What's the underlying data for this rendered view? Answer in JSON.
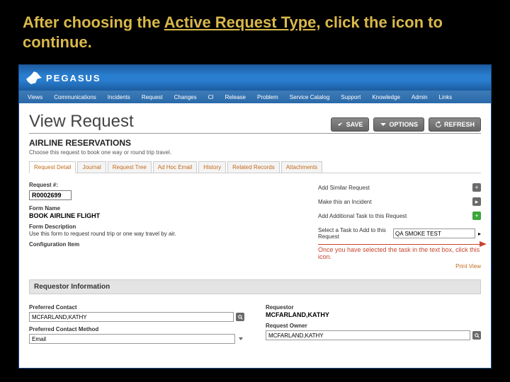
{
  "instruction": {
    "pre": "After choosing the ",
    "link": "Active Request Type,",
    "post": " click the icon  to continue."
  },
  "brand": "PEGASUS",
  "menu": [
    "Views",
    "Communications",
    "Incidents",
    "Request",
    "Changes",
    "CI",
    "Release",
    "Problem",
    "Service Catalog",
    "Support",
    "Knowledge",
    "Admin",
    "Links"
  ],
  "page_title": "View Request",
  "buttons": {
    "save": "SAVE",
    "options": "OPTIONS",
    "refresh": "REFRESH"
  },
  "request_type": "AIRLINE RESERVATIONS",
  "request_type_desc": "Choose this request to book one way or round trip travel.",
  "tabs": [
    "Request Detail",
    "Journal",
    "Request Tree",
    "Ad Hoc Email",
    "History",
    "Related Records",
    "Attachments"
  ],
  "fields": {
    "req_no_label": "Request #:",
    "req_no": "R0002699",
    "form_name_label": "Form Name",
    "form_name": "BOOK AIRLINE FLIGHT",
    "form_desc_label": "Form Description",
    "form_desc": "Use this form to request round trip or one way travel by air.",
    "config_label": "Configuration Item"
  },
  "right_links": {
    "similar": "Add Similar Request",
    "incident": "Make this an Incident",
    "addtask": "Add Additional Task to this Request",
    "select_task": "Select a Task to Add to this Request",
    "task_value": "QA SMOKE TEST",
    "print": "Print View"
  },
  "callout": "Once you have selected the task in the text box, click this icon.",
  "section_requestor": "Requestor Information",
  "requestor": {
    "pref_contact_label": "Preferred Contact",
    "pref_contact": "MCFARLAND,KATHY",
    "pref_method_label": "Preferred Contact Method",
    "pref_method": "Email",
    "requestor_label": "Requestor",
    "requestor": "MCFARLAND,KATHY",
    "owner_label": "Request Owner",
    "owner": "MCFARLAND,KATHY"
  }
}
